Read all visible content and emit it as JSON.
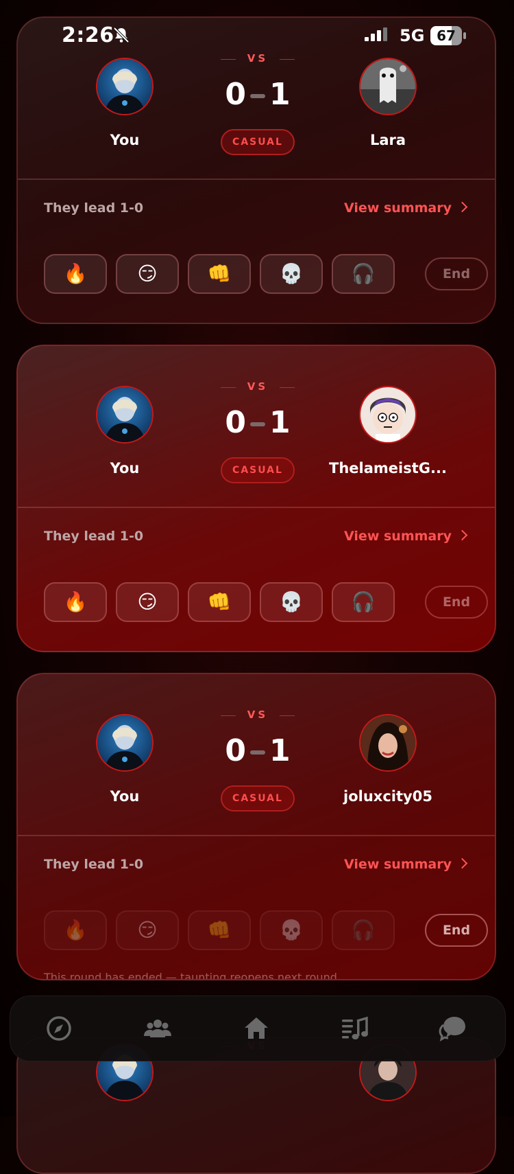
{
  "status_bar": {
    "time": "2:26",
    "network": "5G",
    "battery": "67",
    "battery_level": 0.67
  },
  "matches": [
    {
      "me": "You",
      "opponent": "Lara",
      "vs": "VS",
      "score_me": "0",
      "score_opp": "1",
      "mode": "CASUAL",
      "lead_text": "They lead 1-0",
      "summary_label": "View summary",
      "end_label": "End",
      "opponent_avatar": "ghost-avatar"
    },
    {
      "me": "You",
      "opponent": "ThelameistG...",
      "vs": "VS",
      "score_me": "0",
      "score_opp": "1",
      "mode": "CASUAL",
      "lead_text": "They lead 1-0",
      "summary_label": "View summary",
      "end_label": "End",
      "opponent_avatar": "cartoon-avatar"
    },
    {
      "me": "You",
      "opponent": "joluxcity05",
      "vs": "VS",
      "score_me": "0",
      "score_opp": "1",
      "mode": "CASUAL",
      "lead_text": "They lead 1-0",
      "summary_label": "View summary",
      "end_label": "End",
      "ended_note": "This round has ended — taunting reopens next round.",
      "opponent_avatar": "photo-avatar"
    },
    {
      "vs": "VS"
    }
  ],
  "taunts": [
    {
      "emoji": "🔥",
      "name": "fire"
    },
    {
      "emoji": "😏",
      "name": "smirk"
    },
    {
      "emoji": "👊",
      "name": "fist"
    },
    {
      "emoji": "💀",
      "name": "skull"
    },
    {
      "emoji": "🎧",
      "name": "headphones"
    }
  ],
  "nav": [
    {
      "icon": "compass-icon"
    },
    {
      "icon": "friends-icon"
    },
    {
      "icon": "home-icon"
    },
    {
      "icon": "music-list-icon"
    },
    {
      "icon": "chat-icon"
    }
  ],
  "colors": {
    "accent": "#ff5454",
    "badge_border": "#b01e1e",
    "avatar_ring": "#c21a1a"
  }
}
